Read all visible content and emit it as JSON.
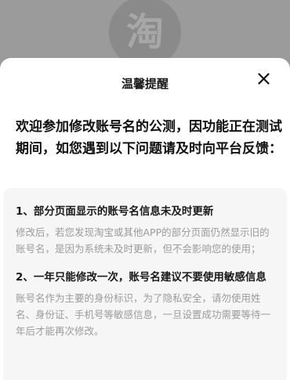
{
  "background": {
    "app_logo_glyph": "淘",
    "app_logo_icon": "taobao-logo-icon"
  },
  "dialog": {
    "title": "温馨提醒",
    "close_icon": "close-icon",
    "intro": "欢迎参加修改账号名的公测，因功能正在测试期间，如您遇到以下问题请及时向平台反馈：",
    "items": [
      {
        "heading": "1、部分页面显示的账号名信息未及时更新",
        "body": "修改后，若您发现淘宝或其他APP的部分页面仍然显示旧的账号名，是因为系统未及时更新，但不会影响您的使用；"
      },
      {
        "heading": "2、一年只能修改一次，账号名建议不要使用敏感信息",
        "body": "账号名作为主要的身份标识，为了隐私安全，请勿使用姓名、身份证、手机号等敏感信息，一旦设置成功需要等待一年后才能再次修改。"
      }
    ]
  },
  "colors": {
    "overlay": "#9b9b9b",
    "sheet": "#ffffff",
    "notice_box": "#f6f6f6",
    "muted_text": "#9b9b9b"
  }
}
